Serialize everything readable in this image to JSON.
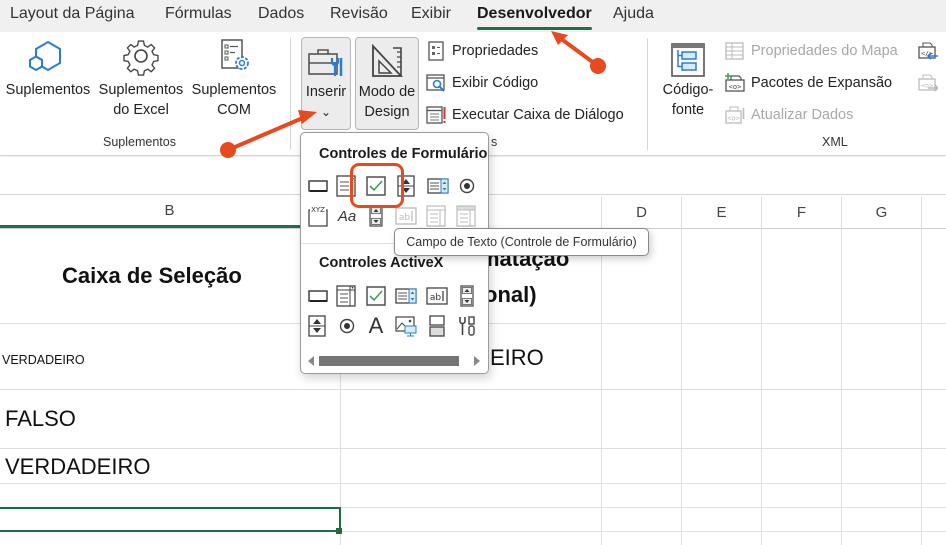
{
  "tabs": [
    {
      "label": "Layout da Página",
      "active": false
    },
    {
      "label": "Fórmulas",
      "active": false
    },
    {
      "label": "Dados",
      "active": false
    },
    {
      "label": "Revisão",
      "active": false
    },
    {
      "label": "Exibir",
      "active": false
    },
    {
      "label": "Desenvolvedor",
      "active": true
    },
    {
      "label": "Ajuda",
      "active": false
    }
  ],
  "ribbon": {
    "suplementos_group": {
      "label": "Suplementos",
      "buttons": [
        {
          "label_line1": "Suplementos",
          "label_line2": "",
          "icon": "hexagons-icon"
        },
        {
          "label_line1": "Suplementos",
          "label_line2": "do Excel",
          "icon": "gear-icon"
        },
        {
          "label_line1": "Suplementos",
          "label_line2": "COM",
          "icon": "list-gear-icon"
        }
      ]
    },
    "controles_group": {
      "label_partial": "s",
      "insert": {
        "label": "Inserir",
        "chevron": "⌄",
        "icon": "toolbox-icon"
      },
      "design_mode": {
        "label_line1": "Modo de",
        "label_line2": "Design",
        "icon": "triangle-ruler-icon"
      },
      "small_buttons": [
        {
          "label": "Propriedades",
          "icon": "properties-icon",
          "disabled": false
        },
        {
          "label": "Exibir Código",
          "icon": "view-code-icon",
          "disabled": false
        },
        {
          "label": "Executar Caixa de Diálogo",
          "icon": "run-dialog-icon",
          "disabled": false
        }
      ]
    },
    "xml_group": {
      "label": "XML",
      "source": {
        "label_line1": "Código-",
        "label_line2": "fonte",
        "icon": "xml-source-icon"
      },
      "small_buttons": [
        {
          "label": "Propriedades do Mapa",
          "icon": "map-properties-icon",
          "disabled": true
        },
        {
          "label": "Pacotes de Expansão",
          "icon": "expansion-packs-icon",
          "disabled": false
        },
        {
          "label": "Atualizar Dados",
          "icon": "refresh-data-icon",
          "disabled": true
        }
      ],
      "side_icons": [
        {
          "icon": "xml-import-icon",
          "disabled": false
        },
        {
          "icon": "xml-export-icon",
          "disabled": true
        }
      ]
    }
  },
  "dropdown": {
    "form_controls_title": "Controles de Formulário",
    "form_controls": [
      {
        "name": "button",
        "icon": "form-button-icon",
        "enabled": true
      },
      {
        "name": "combo-box",
        "icon": "form-combo-box-icon",
        "enabled": true
      },
      {
        "name": "check-box",
        "icon": "form-checkbox-icon",
        "enabled": true,
        "highlighted": true
      },
      {
        "name": "spin-button",
        "icon": "form-spin-button-icon",
        "enabled": true
      },
      {
        "name": "list-box",
        "icon": "form-list-box-icon",
        "enabled": true
      },
      {
        "name": "option-button",
        "icon": "form-option-button-icon",
        "enabled": true
      },
      {
        "name": "group-box",
        "icon": "form-group-box-icon",
        "enabled": true
      },
      {
        "name": "label",
        "icon": "form-label-icon",
        "enabled": true
      },
      {
        "name": "scroll-bar",
        "icon": "form-scroll-bar-icon",
        "enabled": true
      },
      {
        "name": "text-field",
        "icon": "form-text-field-icon",
        "enabled": false
      },
      {
        "name": "combo-list-edit",
        "icon": "form-combo-list-edit-icon",
        "enabled": false
      },
      {
        "name": "combo-drop-edit",
        "icon": "form-combo-drop-edit-icon",
        "enabled": false
      }
    ],
    "activex_title": "Controles ActiveX",
    "activex_controls": [
      {
        "name": "command-button",
        "icon": "activex-command-button-icon"
      },
      {
        "name": "combo-box",
        "icon": "activex-combo-box-icon"
      },
      {
        "name": "check-box",
        "icon": "activex-checkbox-icon"
      },
      {
        "name": "list-box",
        "icon": "activex-list-box-icon"
      },
      {
        "name": "text-box",
        "icon": "activex-text-box-icon"
      },
      {
        "name": "scroll-bar",
        "icon": "activex-scroll-bar-icon"
      },
      {
        "name": "spin-button",
        "icon": "activex-spin-button-icon"
      },
      {
        "name": "option-button",
        "icon": "activex-option-button-icon"
      },
      {
        "name": "label",
        "icon": "activex-label-icon"
      },
      {
        "name": "image",
        "icon": "activex-image-icon"
      },
      {
        "name": "toggle-button",
        "icon": "activex-toggle-button-icon"
      },
      {
        "name": "more-controls",
        "icon": "activex-more-controls-icon"
      }
    ],
    "tooltip": "Campo de Texto (Controle de Formulário)"
  },
  "sheet": {
    "columns": [
      "B",
      "D",
      "E",
      "F",
      "G"
    ],
    "selected_column": "B",
    "header_b": "Caixa de Seleção",
    "header_c_line1": "matação",
    "header_c_line2": "onal)",
    "cells": {
      "b_row1": "VERDADEIRO",
      "b_row2": "FALSO",
      "b_row3": "VERDADEIRO",
      "c_row1": "EIRO"
    }
  },
  "colors": {
    "accent_green": "#1e7145",
    "annotation_orange": "#e8491d",
    "icon_blue": "#2b7cd3",
    "check_green": "#3aa15f"
  }
}
